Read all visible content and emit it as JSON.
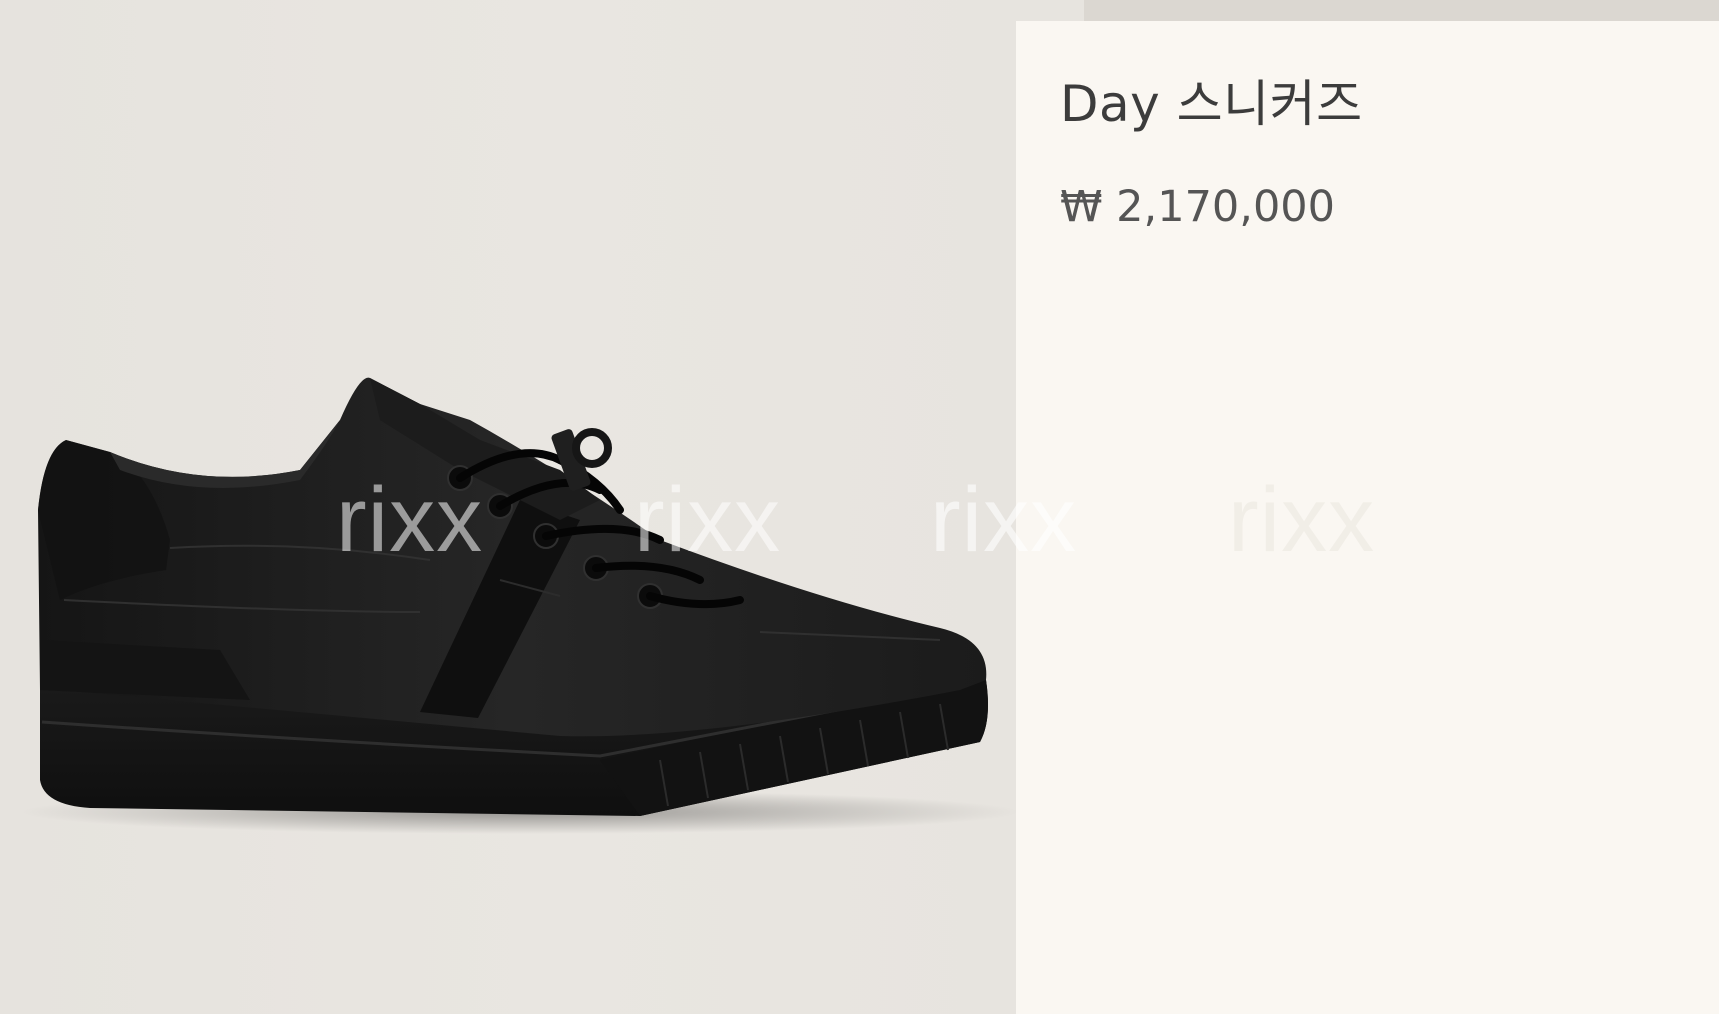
{
  "product": {
    "title": "Day 스니커즈",
    "price": "₩ 2,170,000",
    "image_icon": "sneaker-image"
  },
  "watermarks": [
    "rixx",
    "rixx",
    "rixx",
    "rixx"
  ],
  "colors": {
    "image_background": "#e7e4df",
    "panel_background": "#faf7f2",
    "title_text": "#3c3c3c",
    "price_text": "#555555",
    "shoe": "#1a1a1a"
  }
}
